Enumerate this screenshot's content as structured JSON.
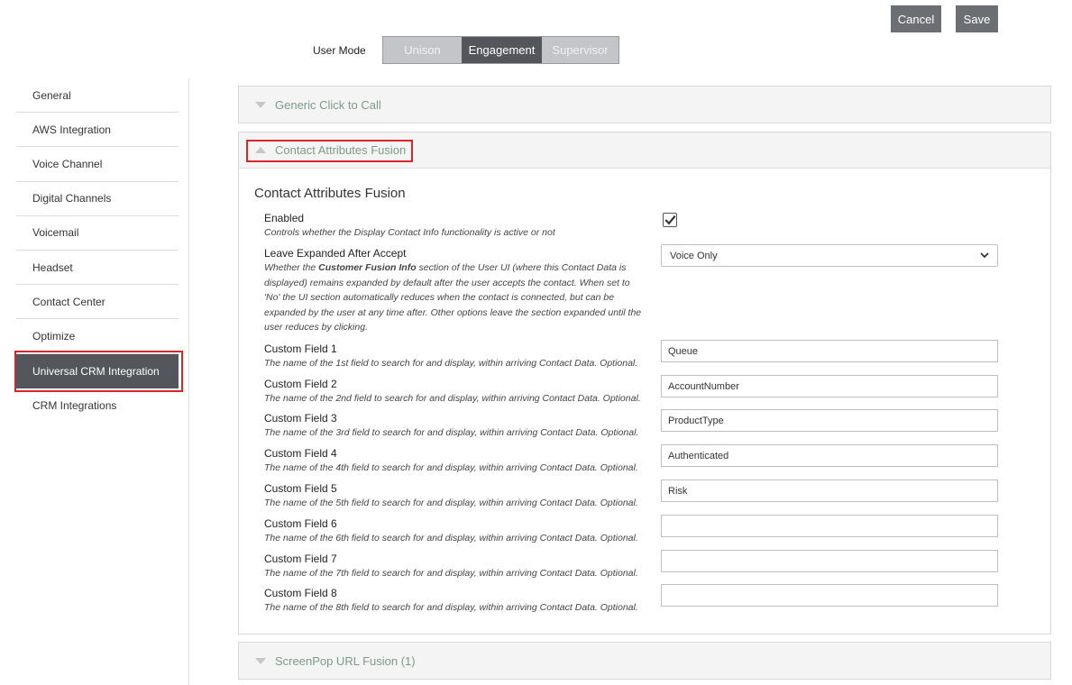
{
  "toolbar": {
    "cancel_label": "Cancel",
    "save_label": "Save"
  },
  "user_mode": {
    "label": "User Mode",
    "options": [
      "Unison",
      "Engagement",
      "Supervisor"
    ],
    "selected": "Engagement"
  },
  "sidebar": {
    "items": [
      {
        "label": "General"
      },
      {
        "label": "AWS Integration"
      },
      {
        "label": "Voice Channel"
      },
      {
        "label": "Digital Channels"
      },
      {
        "label": "Voicemail"
      },
      {
        "label": "Headset"
      },
      {
        "label": "Contact Center"
      },
      {
        "label": "Optimize"
      },
      {
        "label": "Universal CRM Integration"
      },
      {
        "label": "CRM Integrations"
      }
    ],
    "active": "Universal CRM Integration"
  },
  "panels": {
    "generic": {
      "title": "Generic Click to Call"
    },
    "fusion": {
      "title": "Contact Attributes Fusion"
    },
    "screenpop": {
      "title": "ScreenPop URL Fusion (1)"
    }
  },
  "fusion": {
    "section_title": "Contact Attributes Fusion",
    "enabled": {
      "label": "Enabled",
      "desc": "Controls whether the Display Contact Info functionality is active or not",
      "checked": true
    },
    "leave_expanded": {
      "label": "Leave Expanded After Accept",
      "desc_pre": "Whether the ",
      "desc_bold": "Customer Fusion Info",
      "desc_post": " section of the User UI (where this Contact Data is displayed) remains expanded by default after the user accepts the contact. When set to 'No' the UI section automatically reduces when the contact is connected, but can be expanded by the user at any time after. Other options leave the section expanded until the user reduces by clicking.",
      "value": "Voice Only"
    },
    "custom_fields": [
      {
        "label": "Custom Field 1",
        "desc": "The name of the 1st field to search for and display, within arriving Contact Data. Optional.",
        "value": "Queue"
      },
      {
        "label": "Custom Field 2",
        "desc": "The name of the 2nd field to search for and display, within arriving Contact Data. Optional.",
        "value": "AccountNumber"
      },
      {
        "label": "Custom Field 3",
        "desc": "The name of the 3rd field to search for and display, within arriving Contact Data. Optional.",
        "value": "ProductType"
      },
      {
        "label": "Custom Field 4",
        "desc": "The name of the 4th field to search for and display, within arriving Contact Data. Optional.",
        "value": "Authenticated"
      },
      {
        "label": "Custom Field 5",
        "desc": "The name of the 5th field to search for and display, within arriving Contact Data. Optional.",
        "value": "Risk"
      },
      {
        "label": "Custom Field 6",
        "desc": "The name of the 6th field to search for and display, within arriving Contact Data. Optional.",
        "value": ""
      },
      {
        "label": "Custom Field 7",
        "desc": "The name of the 7th field to search for and display, within arriving Contact Data. Optional.",
        "value": ""
      },
      {
        "label": "Custom Field 8",
        "desc": "The name of the 8th field to search for and display, within arriving Contact Data. Optional.",
        "value": ""
      }
    ]
  },
  "colors": {
    "button_bg": "#6b6f74",
    "active_bg": "#53575c",
    "highlight": "#d9262b",
    "panel_title": "#7d9b89"
  }
}
